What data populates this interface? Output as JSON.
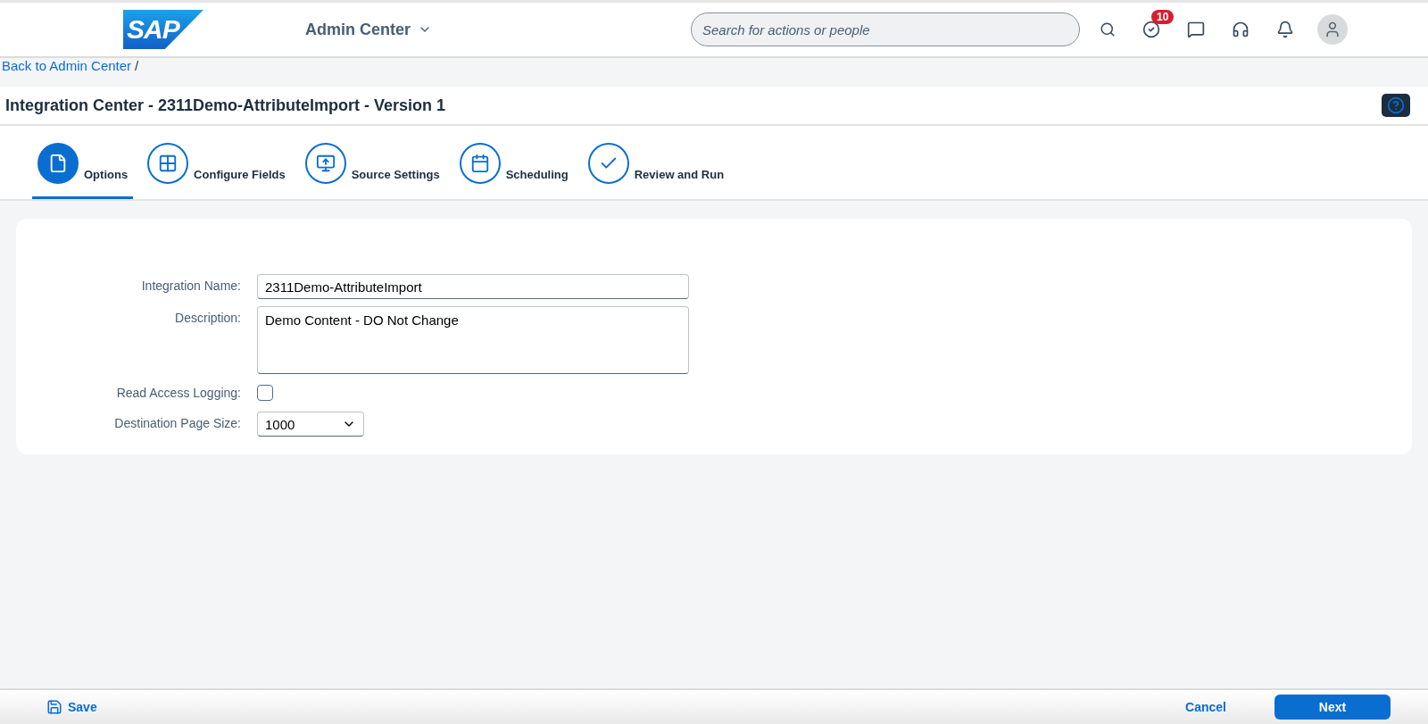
{
  "header": {
    "logo": "SAP",
    "app_menu": "Admin Center",
    "search": {
      "placeholder": "Search for actions or people"
    },
    "todo_badge": "10"
  },
  "breadcrumb": {
    "link": "Back to Admin Center",
    "separator": "/"
  },
  "page_title": "Integration Center - 2311Demo-AttributeImport - Version 1",
  "steps": [
    {
      "label": "Options",
      "kind": "document",
      "selected": true
    },
    {
      "label": "Configure Fields",
      "kind": "grid",
      "selected": false
    },
    {
      "label": "Source Settings",
      "kind": "upload",
      "selected": false
    },
    {
      "label": "Scheduling",
      "kind": "calendar",
      "selected": false
    },
    {
      "label": "Review and Run",
      "kind": "check",
      "selected": false
    }
  ],
  "form": [
    {
      "label": "Integration Name:",
      "kind": "text",
      "value": "2311Demo-AttributeImport"
    },
    {
      "label": "Description:",
      "kind": "textarea",
      "value": "Demo Content - DO Not Change"
    },
    {
      "label": "Read Access Logging:",
      "kind": "checkbox",
      "checked": false
    },
    {
      "label": "Destination Page Size:",
      "kind": "select",
      "value": "1000"
    }
  ],
  "footer": {
    "save": "Save",
    "cancel": "Cancel",
    "next": "Next"
  }
}
